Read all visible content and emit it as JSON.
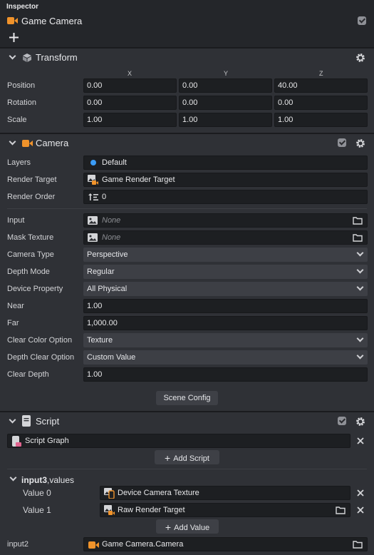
{
  "inspector": {
    "title": "Inspector",
    "object_name": "Game Camera",
    "add_icon": "plus-icon"
  },
  "transform": {
    "title": "Transform",
    "axes": [
      "X",
      "Y",
      "Z"
    ],
    "rows": [
      {
        "label": "Position",
        "values": [
          "0.00",
          "0.00",
          "40.00"
        ]
      },
      {
        "label": "Rotation",
        "values": [
          "0.00",
          "0.00",
          "0.00"
        ]
      },
      {
        "label": "Scale",
        "values": [
          "1.00",
          "1.00",
          "1.00"
        ]
      }
    ]
  },
  "camera": {
    "title": "Camera",
    "layers_label": "Layers",
    "layers_value": "Default",
    "render_target_label": "Render Target",
    "render_target_value": "Game Render Target",
    "render_order_label": "Render Order",
    "render_order_value": "0",
    "input_label": "Input",
    "input_value": "None",
    "mask_texture_label": "Mask Texture",
    "mask_texture_value": "None",
    "camera_type_label": "Camera Type",
    "camera_type_value": "Perspective",
    "depth_mode_label": "Depth Mode",
    "depth_mode_value": "Regular",
    "device_property_label": "Device Property",
    "device_property_value": "All Physical",
    "near_label": "Near",
    "near_value": "1.00",
    "far_label": "Far",
    "far_value": "1,000.00",
    "clear_color_label": "Clear Color Option",
    "clear_color_value": "Texture",
    "depth_clear_label": "Depth Clear Option",
    "depth_clear_value": "Custom Value",
    "clear_depth_label": "Clear Depth",
    "clear_depth_value": "1.00",
    "scene_config_label": "Scene Config"
  },
  "script": {
    "title": "Script",
    "script_value": "Script Graph",
    "add_script_label": "Add Script",
    "input3_title": "input3",
    "input3_suffix": ",values",
    "value0_label": "Value 0",
    "value0_value": "Device Camera Texture",
    "value1_label": "Value 1",
    "value1_value": "Raw Render Target",
    "add_value_label": "Add Value",
    "input2_label": "input2",
    "input2_value": "Game Camera.Camera"
  },
  "colors": {
    "accent_orange": "#f0932b",
    "layer_blue": "#3b9cf6",
    "script_pink": "#e1648f"
  }
}
